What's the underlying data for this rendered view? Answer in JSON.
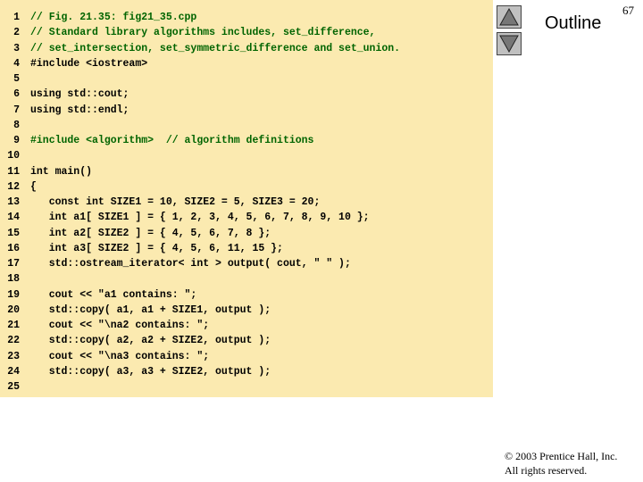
{
  "slide": {
    "outline_label": "Outline",
    "page_number": "67",
    "nav_up_icon": "triangle-up-icon",
    "nav_down_icon": "triangle-down-icon",
    "copyright_line1": "© 2003 Prentice Hall, Inc.",
    "copyright_line2": "All rights reserved."
  },
  "code": {
    "lines": [
      {
        "num": "1",
        "text": "// Fig. 21.35: fig21_35.cpp"
      },
      {
        "num": "2",
        "text": "// Standard library algorithms includes, set_difference,"
      },
      {
        "num": "3",
        "text": "// set_intersection, set_symmetric_difference and set_union."
      },
      {
        "num": "4",
        "text": "#include <iostream>"
      },
      {
        "num": "5",
        "text": ""
      },
      {
        "num": "6",
        "text": "using std::cout;"
      },
      {
        "num": "7",
        "text": "using std::endl;"
      },
      {
        "num": "8",
        "text": ""
      },
      {
        "num": "9",
        "text": "#include <algorithm>  // algorithm definitions"
      },
      {
        "num": "10",
        "text": ""
      },
      {
        "num": "11",
        "text": "int main()"
      },
      {
        "num": "12",
        "text": "{"
      },
      {
        "num": "13",
        "text": "   const int SIZE1 = 10, SIZE2 = 5, SIZE3 = 20;"
      },
      {
        "num": "14",
        "text": "   int a1[ SIZE1 ] = { 1, 2, 3, 4, 5, 6, 7, 8, 9, 10 };"
      },
      {
        "num": "15",
        "text": "   int a2[ SIZE2 ] = { 4, 5, 6, 7, 8 };"
      },
      {
        "num": "16",
        "text": "   int a3[ SIZE2 ] = { 4, 5, 6, 11, 15 };"
      },
      {
        "num": "17",
        "text": "   std::ostream_iterator< int > output( cout, \" \" );"
      },
      {
        "num": "18",
        "text": ""
      },
      {
        "num": "19",
        "text": "   cout << \"a1 contains: \";"
      },
      {
        "num": "20",
        "text": "   std::copy( a1, a1 + SIZE1, output );"
      },
      {
        "num": "21",
        "text": "   cout << \"\\na2 contains: \";"
      },
      {
        "num": "22",
        "text": "   std::copy( a2, a2 + SIZE2, output );"
      },
      {
        "num": "23",
        "text": "   cout << \"\\na3 contains: \";"
      },
      {
        "num": "24",
        "text": "   std::copy( a3, a3 + SIZE2, output );"
      },
      {
        "num": "25",
        "text": ""
      }
    ]
  }
}
